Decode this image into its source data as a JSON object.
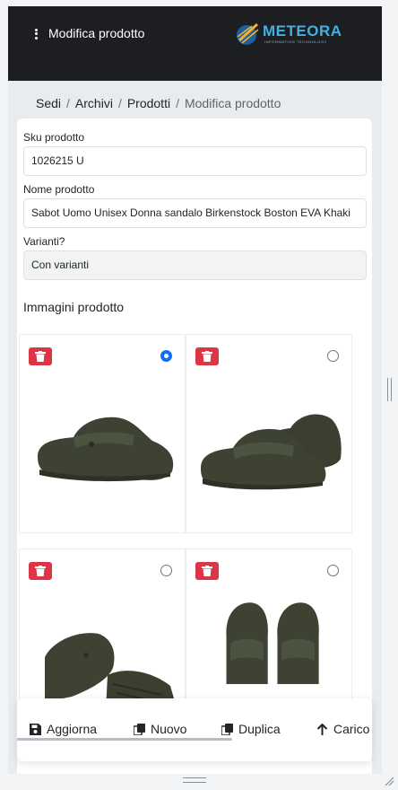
{
  "header": {
    "title": "Modifica prodotto",
    "logo_text": "METEORA",
    "logo_subtitle": "INFORMATION TECHNOLOGY"
  },
  "breadcrumb": [
    "Sedi",
    "Archivi",
    "Prodotti",
    "Modifica prodotto"
  ],
  "form": {
    "sku_label": "Sku prodotto",
    "sku_value": "1026215 U",
    "name_label": "Nome prodotto",
    "name_value": "Sabot Uomo Unisex Donna sandalo Birkenstock Boston EVA Khaki",
    "variants_label": "Varianti?",
    "variants_value": "Con varianti"
  },
  "images": {
    "section_title": "Immagini prodotto",
    "items": [
      {
        "selected": true
      },
      {
        "selected": false
      },
      {
        "selected": false
      },
      {
        "selected": false
      }
    ]
  },
  "toolbar": {
    "update_label": "Aggiorna",
    "new_label": "Nuovo",
    "duplicate_label": "Duplica",
    "load_label": "Carico"
  },
  "colors": {
    "header_bg": "#1d1e21",
    "danger": "#dc3545",
    "primary": "#0d6efd",
    "shoe": "#3d4233"
  }
}
